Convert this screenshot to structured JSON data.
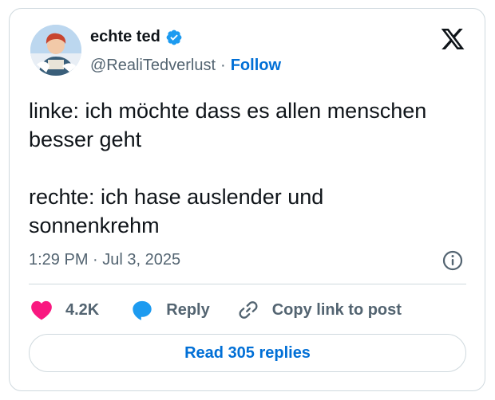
{
  "author": {
    "name": "echte ted",
    "handle": "@RealiTedverlust",
    "separator": "·",
    "follow_label": "Follow",
    "verified_color": "#1d9bf0"
  },
  "tweet": {
    "text": "linke: ich möchte dass es allen menschen besser geht\n\nrechte: ich hase auslender und sonnenkrehm",
    "timestamp": "1:29 PM · Jul 3, 2025"
  },
  "actions": {
    "like_count": "4.2K",
    "like_icon": "heart-icon",
    "like_color": "#f91880",
    "reply_label": "Reply",
    "reply_icon": "speech-bubble-icon",
    "reply_color": "#1d9bf0",
    "copy_label": "Copy link to post",
    "copy_icon": "link-icon"
  },
  "read_replies_label": "Read 305 replies",
  "icons": {
    "brand": "x-logo-icon",
    "info": "info-icon"
  }
}
